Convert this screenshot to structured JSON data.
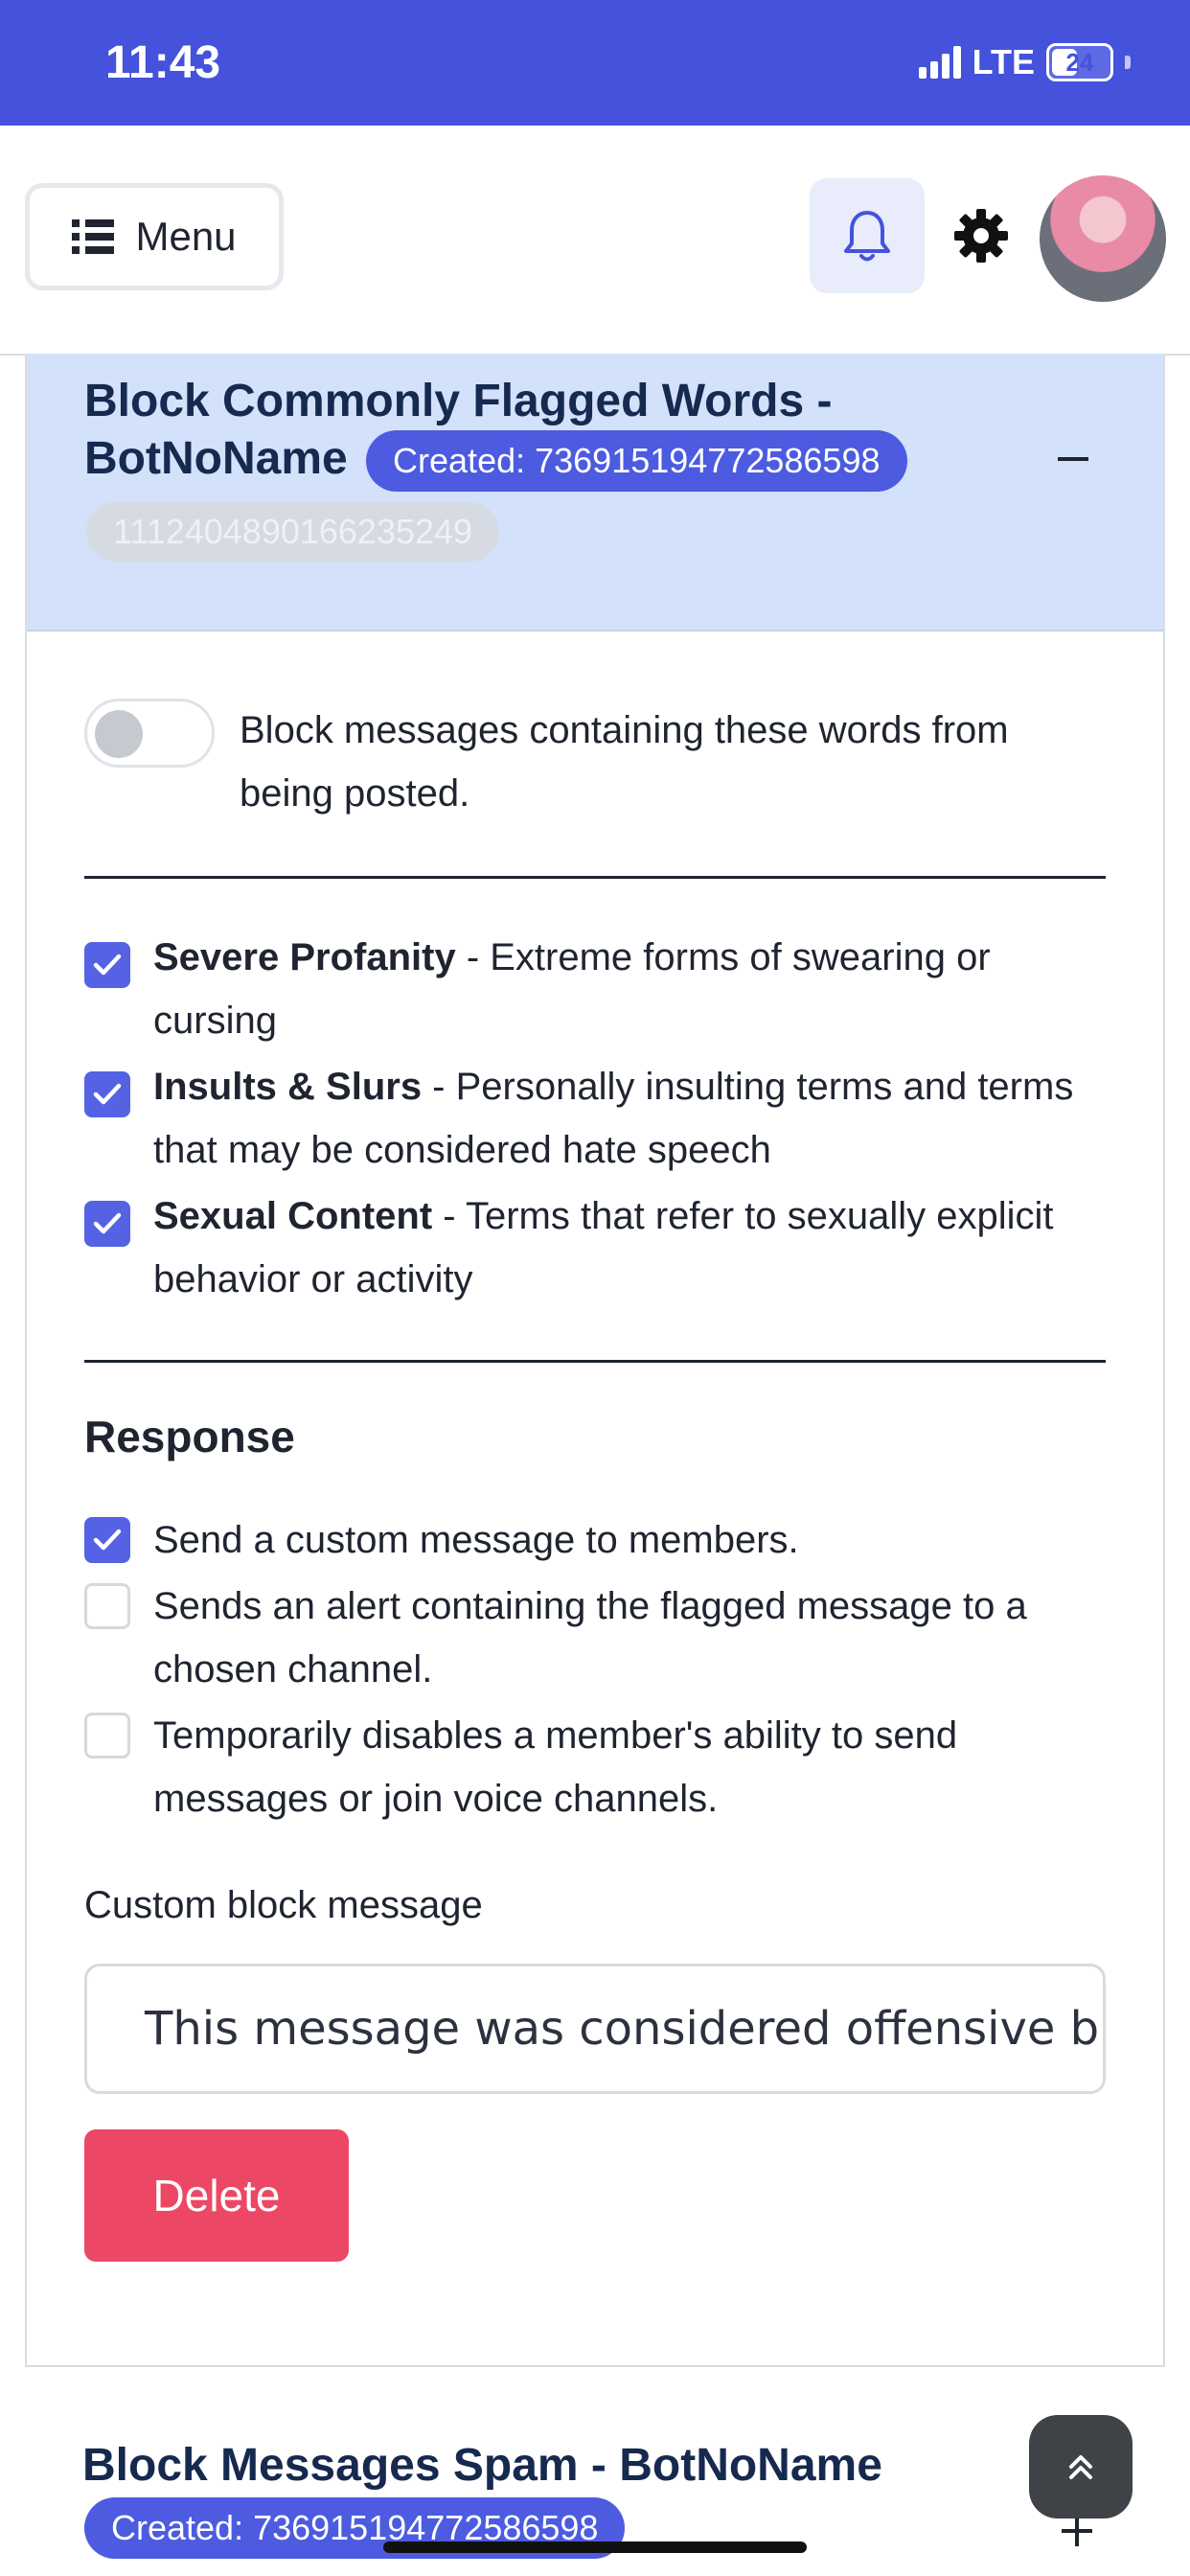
{
  "status_bar": {
    "time": "11:43",
    "network": "LTE",
    "battery": "24"
  },
  "header": {
    "menu_label": "Menu"
  },
  "card1": {
    "title": "Block Commonly Flagged Words - BotNoName",
    "created_badge": "Created: 736915194772586598",
    "id_badge": "1112404890166235249",
    "toggle_label": "Block messages containing these words from being posted.",
    "categories": [
      {
        "name": "Severe Profanity",
        "desc": " - Extreme forms of swearing or cursing",
        "checked": true
      },
      {
        "name": "Insults & Slurs",
        "desc": " - Personally insulting terms and terms that may be considered hate speech",
        "checked": true
      },
      {
        "name": "Sexual Content",
        "desc": " - Terms that refer to sexually explicit behavior or activity",
        "checked": true
      }
    ],
    "response_heading": "Response",
    "responses": [
      {
        "label": "Send a custom message to members.",
        "checked": true
      },
      {
        "label": "Sends an alert containing the flagged message to a chosen channel.",
        "checked": false
      },
      {
        "label": "Temporarily disables a member's ability to send messages or join voice channels.",
        "checked": false
      }
    ],
    "custom_label": "Custom block message",
    "custom_value": "This message was considered offensive b",
    "delete_label": "Delete"
  },
  "card2": {
    "title": "Block Messages Spam - BotNoName",
    "created_badge": "Created: 736915194772586598"
  }
}
